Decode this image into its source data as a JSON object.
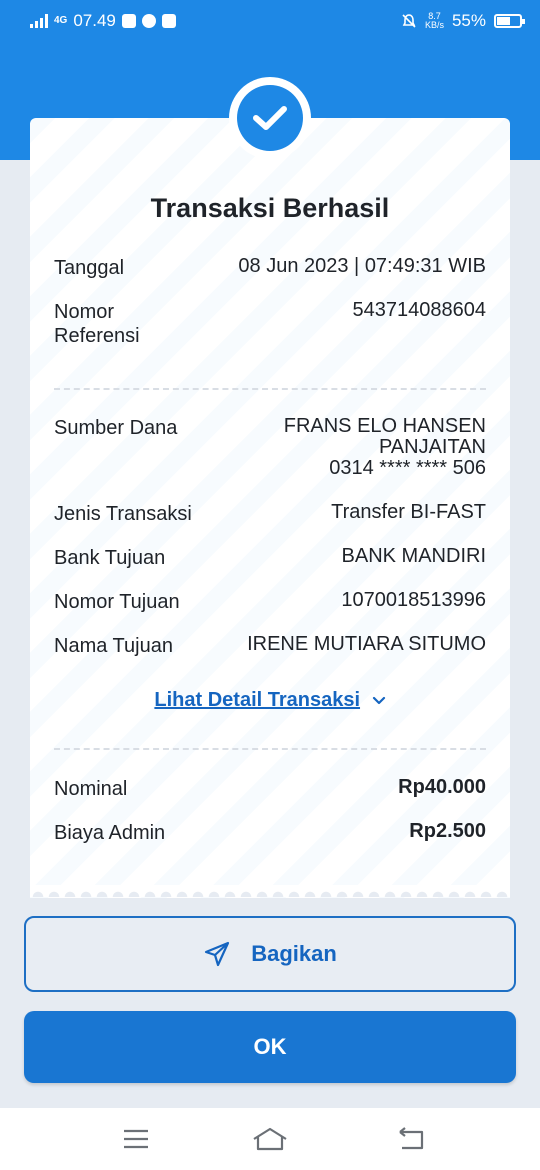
{
  "status_bar": {
    "network": "4G",
    "time": "07.49",
    "speed_value": "8.7",
    "speed_unit": "KB/s",
    "battery": "55%"
  },
  "receipt": {
    "title": "Transaksi Berhasil",
    "rows_top": [
      {
        "label": "Tanggal",
        "value": "08 Jun 2023 | 07:49:31 WIB"
      },
      {
        "label": "Nomor Referensi",
        "value": "543714088604"
      }
    ],
    "source": {
      "label": "Sumber Dana",
      "name_line1": "FRANS ELO HANSEN",
      "name_line2": "PANJAITAN",
      "account": "0314 **** **** 506"
    },
    "rows_mid": [
      {
        "label": "Jenis Transaksi",
        "value": "Transfer BI-FAST"
      },
      {
        "label": "Bank Tujuan",
        "value": "BANK MANDIRI"
      },
      {
        "label": "Nomor Tujuan",
        "value": "1070018513996"
      },
      {
        "label": "Nama Tujuan",
        "value": "IRENE MUTIARA SITUMO"
      }
    ],
    "detail_link": "Lihat Detail Transaksi",
    "rows_amount": [
      {
        "label": "Nominal",
        "value": "Rp40.000"
      },
      {
        "label": "Biaya Admin",
        "value": "Rp2.500"
      }
    ]
  },
  "actions": {
    "share_label": "Bagikan",
    "ok_label": "OK"
  },
  "icons": {
    "success": "check-icon",
    "share": "send-icon",
    "expand": "chevron-down-icon",
    "nav_menu": "menu-icon",
    "nav_home": "home-icon",
    "nav_back": "back-icon"
  },
  "colors": {
    "brand_blue": "#1e88e5",
    "button_blue": "#1976d2",
    "link_blue": "#1565c0"
  }
}
